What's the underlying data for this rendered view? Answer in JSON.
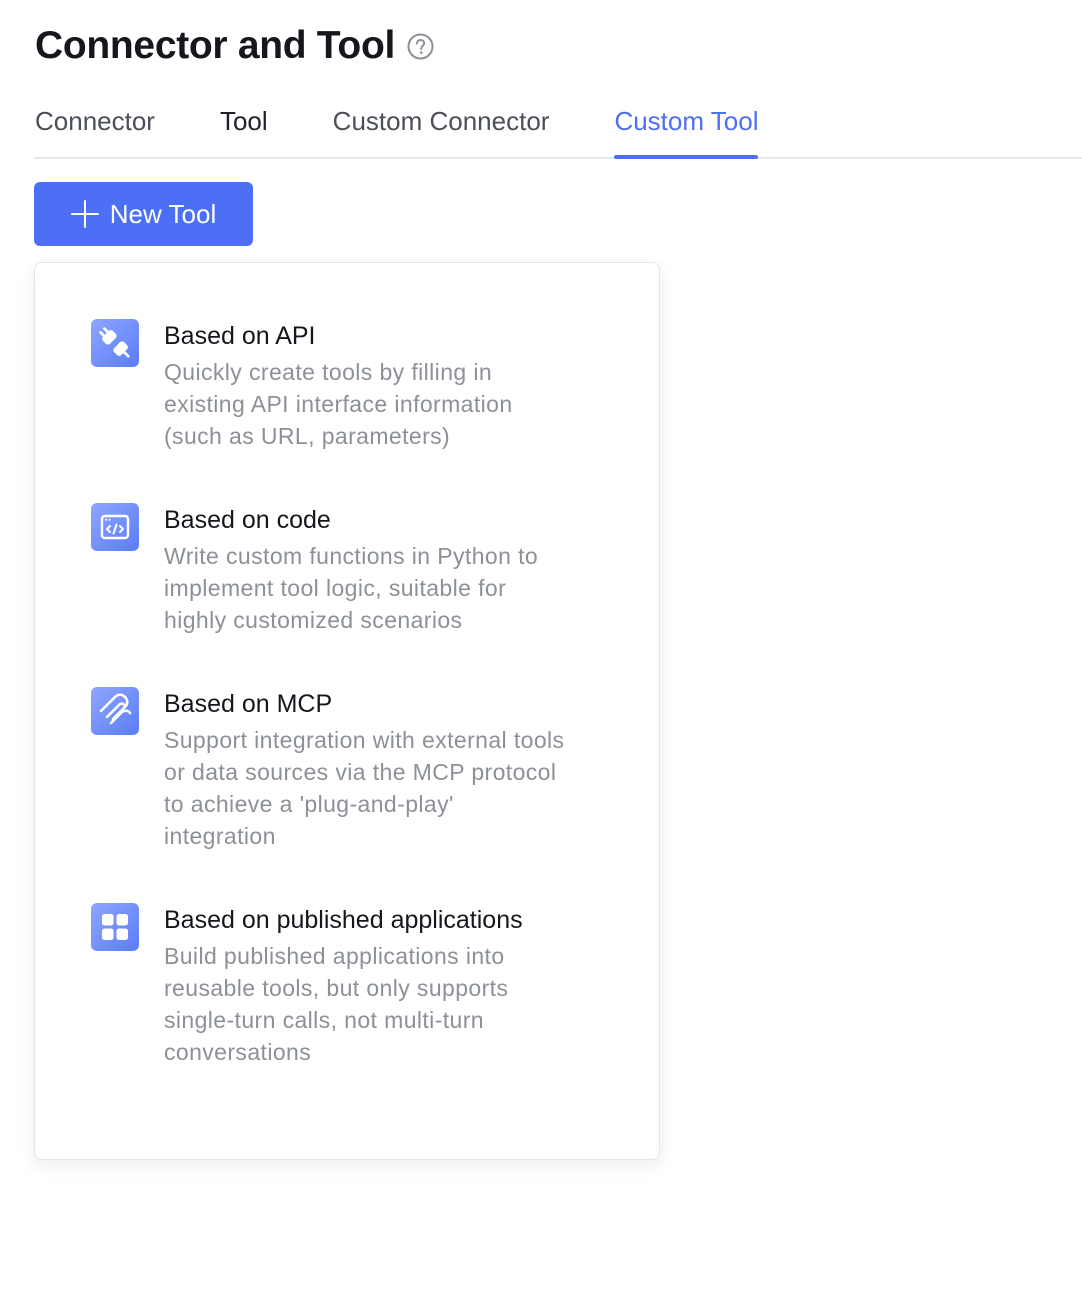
{
  "header": {
    "title": "Connector and Tool",
    "help_icon": "question-circle-icon"
  },
  "tabs": [
    {
      "label": "Connector",
      "active": false
    },
    {
      "label": "Tool",
      "active": false
    },
    {
      "label": "Custom Connector",
      "active": false
    },
    {
      "label": "Custom Tool",
      "active": true
    }
  ],
  "new_tool_button": {
    "label": "New Tool",
    "icon": "plus-icon"
  },
  "menu": {
    "items": [
      {
        "title": "Based on API",
        "desc_lines": [
          "Quickly create tools by filling in",
          "existing API interface information",
          "(such as URL, parameters)"
        ],
        "icon": "plug-icon"
      },
      {
        "title": "Based on code",
        "desc_lines": [
          "Write custom functions in Python to",
          "implement tool logic, suitable for",
          "highly customized scenarios"
        ],
        "icon": "code-window-icon"
      },
      {
        "title": "Based on MCP",
        "desc_lines": [
          "Support integration with external tools",
          "or data sources via the MCP protocol",
          "to achieve a 'plug-and-play'",
          "integration"
        ],
        "icon": "mcp-link-icon"
      },
      {
        "title": "Based on published applications",
        "desc_lines": [
          "Build published applications into",
          "reusable tools, but only supports",
          "single-turn calls, not multi-turn",
          "conversations"
        ],
        "icon": "app-grid-icon"
      }
    ]
  },
  "colors": {
    "accent": "#4d6ff5",
    "text_primary": "#15171c",
    "text_secondary": "#8c9097",
    "divider": "#e6e8ec"
  }
}
